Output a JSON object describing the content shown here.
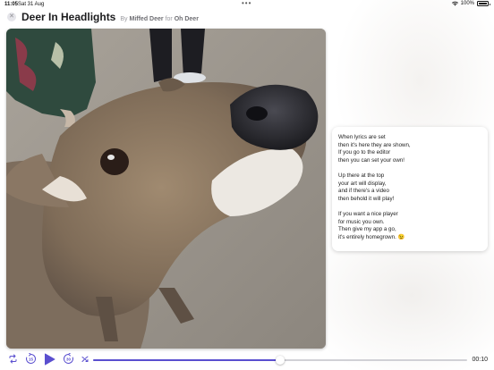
{
  "status_bar": {
    "time": "11:05",
    "date": "Sat 31 Aug",
    "battery": "100%"
  },
  "header": {
    "title": "Deer In Headlights",
    "by_label": "By",
    "artist": "Miffed Deer",
    "for_label": "for",
    "album": "Oh Deer"
  },
  "lyrics": {
    "stanzas": [
      [
        "When lyrics are set",
        "then it's here they are shown,",
        "If you go to the editor",
        "then you can set your own!"
      ],
      [
        "Up there at the top",
        "your art will display,",
        "and if there's a video",
        "then behold it will play!"
      ],
      [
        "If you want a nice player",
        "for music you own.",
        "Then give my app a go,",
        "it's entirely homegrown. 😉"
      ]
    ]
  },
  "player": {
    "elapsed": "00:10",
    "progress": 0.5,
    "accent_color": "#5a4fcf",
    "skip_back_seconds": "15",
    "skip_forward_seconds": "30",
    "icons": {
      "repeat": "repeat-icon",
      "skip_back": "skip-back-15-icon",
      "play": "play-icon",
      "skip_forward": "skip-forward-30-icon",
      "shuffle": "shuffle-icon"
    }
  }
}
